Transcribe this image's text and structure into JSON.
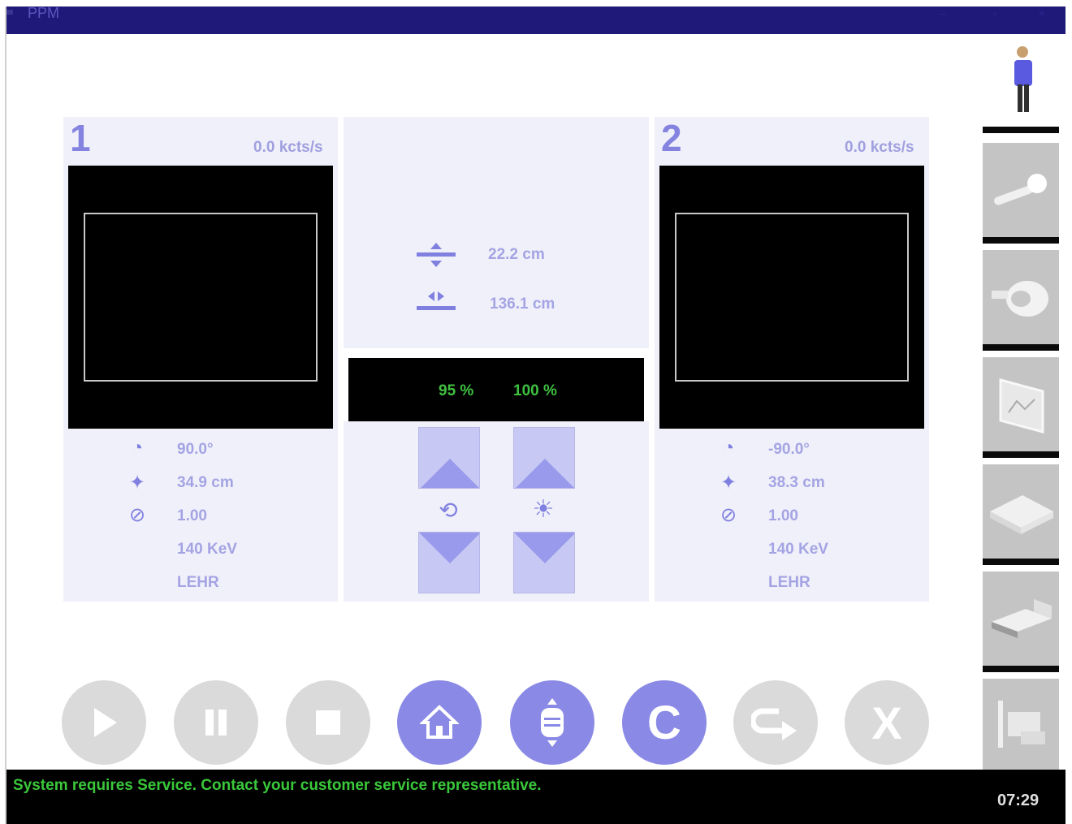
{
  "window": {
    "title": "PPM",
    "controls": [
      "minimize-icon",
      "restore-icon",
      "close-icon"
    ]
  },
  "detector1": {
    "number": "1",
    "count_rate": "0.0 kcts/s",
    "angle": "90.0°",
    "radius": "34.9 cm",
    "zoom": "1.00",
    "energy": "140 KeV",
    "collimator": "LEHR"
  },
  "detector2": {
    "number": "2",
    "count_rate": "0.0 kcts/s",
    "angle": "-90.0°",
    "radius": "38.3 cm",
    "zoom": "1.00",
    "energy": "140 KeV",
    "collimator": "LEHR"
  },
  "table": {
    "height": "22.2 cm",
    "in_out": "136.1 cm"
  },
  "speed": {
    "rotation_percent": "95 %",
    "brightness_percent": "100 %"
  },
  "bottom_controls": [
    {
      "name": "play",
      "icon": "play-icon",
      "enabled": false
    },
    {
      "name": "pause",
      "icon": "pause-icon",
      "enabled": false
    },
    {
      "name": "stop",
      "icon": "stop-icon",
      "enabled": false
    },
    {
      "name": "home",
      "icon": "home-icon",
      "enabled": true
    },
    {
      "name": "table-position",
      "icon": "table-position-icon",
      "enabled": true
    },
    {
      "name": "clear",
      "label": "C",
      "enabled": true
    },
    {
      "name": "next",
      "icon": "redo-arrow-icon",
      "enabled": false
    },
    {
      "name": "exit",
      "label": "X",
      "enabled": false
    }
  ],
  "sidebar": [
    "patient-icon",
    "probe-icon",
    "detector-icon",
    "monitor-icon",
    "collimator-tray-icon",
    "table-icon",
    "service-icon"
  ],
  "status": {
    "message": "System requires Service. Contact your customer service representative.",
    "time": "07:29"
  },
  "colors": {
    "title_bar": "#1f1a7a",
    "accent": "#8a8ae6",
    "status_text": "#3ac83a",
    "percent_text": "#40c040"
  }
}
